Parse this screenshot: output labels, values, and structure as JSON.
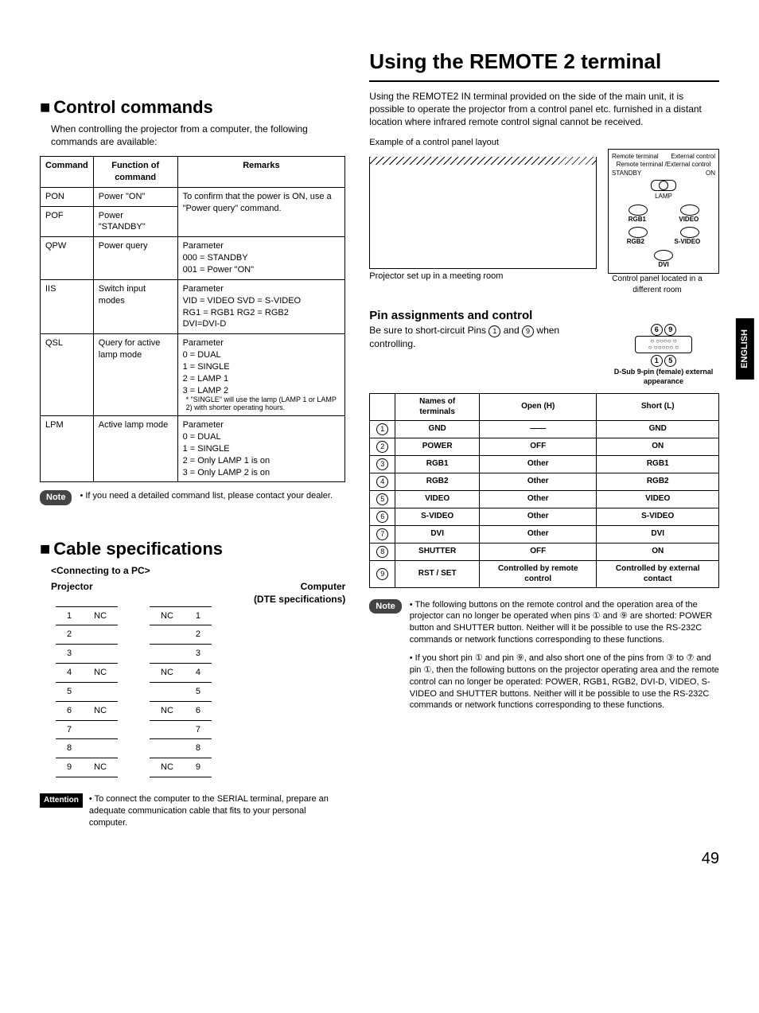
{
  "left": {
    "section1_title": "Control commands",
    "section1_intro": "When controlling the projector from a computer, the following commands are available:",
    "cmd_headers": [
      "Command",
      "Function of command",
      "Remarks"
    ],
    "cmds": [
      {
        "cmd": "PON",
        "func": "Power \"ON\"",
        "remark": "To confirm that the power is ON, use a \"Power query\" command."
      },
      {
        "cmd": "POF",
        "func": "Power \"STANDBY\"",
        "remark": ""
      },
      {
        "cmd": "QPW",
        "func": "Power query",
        "remark": "Parameter\n000 = STANDBY\n001 = Power \"ON\""
      },
      {
        "cmd": "IIS",
        "func": "Switch input modes",
        "remark": "Parameter\nVID = VIDEO   SVD = S-VIDEO\nRG1 = RGB1   RG2 = RGB2\nDVI=DVI-D"
      },
      {
        "cmd": "QSL",
        "func": "Query for active lamp mode",
        "remark": "Parameter\n0 = DUAL\n1 = SINGLE\n2 = LAMP 1\n3 = LAMP 2",
        "remark_note": "* \"SINGLE\" will use the lamp (LAMP 1 or LAMP 2) with shorter operating hours."
      },
      {
        "cmd": "LPM",
        "func": "Active lamp mode",
        "remark": "Parameter\n0 = DUAL\n1 = SINGLE\n2 = Only LAMP 1 is on\n3 = Only LAMP 2 is on"
      }
    ],
    "note_label": "Note",
    "note_text": "• If you need a detailed command list, please contact your dealer.",
    "section2_title": "Cable specifications",
    "cable_sub": "<Connecting to a PC>",
    "cable_h1": "Projector",
    "cable_h2": "Computer",
    "cable_h2b": "(DTE specifications)",
    "cable_rows": [
      [
        "1",
        "NC",
        "NC",
        "1"
      ],
      [
        "2",
        "",
        "",
        "2"
      ],
      [
        "3",
        "",
        "",
        "3"
      ],
      [
        "4",
        "NC",
        "NC",
        "4"
      ],
      [
        "5",
        "",
        "",
        "5"
      ],
      [
        "6",
        "NC",
        "NC",
        "6"
      ],
      [
        "7",
        "",
        "",
        "7"
      ],
      [
        "8",
        "",
        "",
        "8"
      ],
      [
        "9",
        "NC",
        "NC",
        "9"
      ]
    ],
    "attention_label": "Attention",
    "attention_text": "• To connect the computer to the SERIAL terminal, prepare an adequate communication cable that fits to your personal computer."
  },
  "right": {
    "main_title": "Using the REMOTE 2 terminal",
    "intro": "Using the REMOTE2 IN terminal provided on the side of the main unit, it is possible to operate the projector from a control panel etc. furnished in a distant location where infrared remote control signal cannot be received.",
    "example_label": "Example of a control panel layout",
    "meeting_caption": "Projector set up in a meeting room",
    "panel_caption": "Control panel located in a different room",
    "panel_labels": {
      "remote_terminal": "Remote terminal",
      "external_control": "External control",
      "combined": "Remote terminal /External control",
      "standby": "STANDBY",
      "on": "ON",
      "lamp": "LAMP",
      "rgb1": "RGB1",
      "video": "VIDEO",
      "rgb2": "RGB2",
      "svideo": "S-VIDEO",
      "dvi": "DVI"
    },
    "sub_head": "Pin assignments and control",
    "sub_text_a": "Be sure to short-circuit Pins ",
    "sub_text_b": " and ",
    "sub_text_c": " when controlling.",
    "connector_caption": "D-Sub 9-pin (female) external appearance",
    "pin_headers": [
      "",
      "Names of terminals",
      "Open (H)",
      "Short (L)"
    ],
    "pin_rows": [
      [
        "1",
        "GND",
        "——",
        "GND"
      ],
      [
        "2",
        "POWER",
        "OFF",
        "ON"
      ],
      [
        "3",
        "RGB1",
        "Other",
        "RGB1"
      ],
      [
        "4",
        "RGB2",
        "Other",
        "RGB2"
      ],
      [
        "5",
        "VIDEO",
        "Other",
        "VIDEO"
      ],
      [
        "6",
        "S-VIDEO",
        "Other",
        "S-VIDEO"
      ],
      [
        "7",
        "DVI",
        "Other",
        "DVI"
      ],
      [
        "8",
        "SHUTTER",
        "OFF",
        "ON"
      ],
      [
        "9",
        "RST / SET",
        "Controlled by remote control",
        "Controlled by external contact"
      ]
    ],
    "note_label": "Note",
    "note1": "• The following buttons on the remote control and the operation area of the projector can no longer be operated when pins ① and ⑨ are shorted: POWER button and SHUTTER button. Neither will it be possible to use the RS-232C commands or network functions corresponding to these functions.",
    "note2": "• If you short pin ① and pin ⑨, and also short one of the pins from ③ to ⑦ and pin ①, then the following buttons on the projector operating area and the remote control can no longer be operated: POWER, RGB1, RGB2, DVI-D, VIDEO, S-VIDEO and SHUTTER buttons. Neither will it be possible to use the RS-232C commands or network functions corresponding to these functions.",
    "english_tab": "ENGLISH",
    "page": "49"
  }
}
